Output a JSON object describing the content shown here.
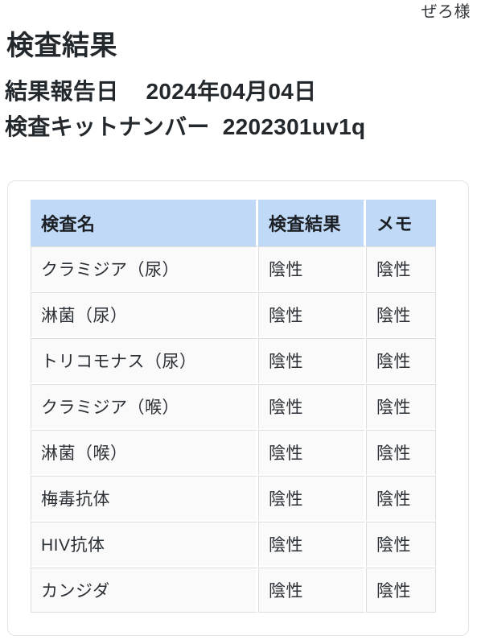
{
  "header": {
    "user_name": "ぜろ様"
  },
  "page": {
    "title": "検査結果"
  },
  "meta": {
    "report_date_label": "結果報告日",
    "report_date_value": "2024年04月04日",
    "kit_number_label": "検査キットナンバー",
    "kit_number_value": "2202301uv1q"
  },
  "table": {
    "columns": [
      {
        "key": "name",
        "label": "検査名"
      },
      {
        "key": "result",
        "label": "検査結果"
      },
      {
        "key": "memo",
        "label": "メモ"
      }
    ],
    "rows": [
      {
        "name": "クラミジア（尿）",
        "result": "陰性",
        "memo": "陰性"
      },
      {
        "name": "淋菌（尿）",
        "result": "陰性",
        "memo": "陰性"
      },
      {
        "name": "トリコモナス（尿）",
        "result": "陰性",
        "memo": "陰性"
      },
      {
        "name": "クラミジア（喉）",
        "result": "陰性",
        "memo": "陰性"
      },
      {
        "name": "淋菌（喉）",
        "result": "陰性",
        "memo": "陰性"
      },
      {
        "name": "梅毒抗体",
        "result": "陰性",
        "memo": "陰性"
      },
      {
        "name": "HIV抗体",
        "result": "陰性",
        "memo": "陰性"
      },
      {
        "name": "カンジダ",
        "result": "陰性",
        "memo": "陰性"
      }
    ]
  },
  "colors": {
    "header_row_bg": "#bfd9f7",
    "cell_bg": "#fafafa",
    "cell_border": "#dedede",
    "card_border": "#e3e3e3",
    "text": "#23282d"
  }
}
